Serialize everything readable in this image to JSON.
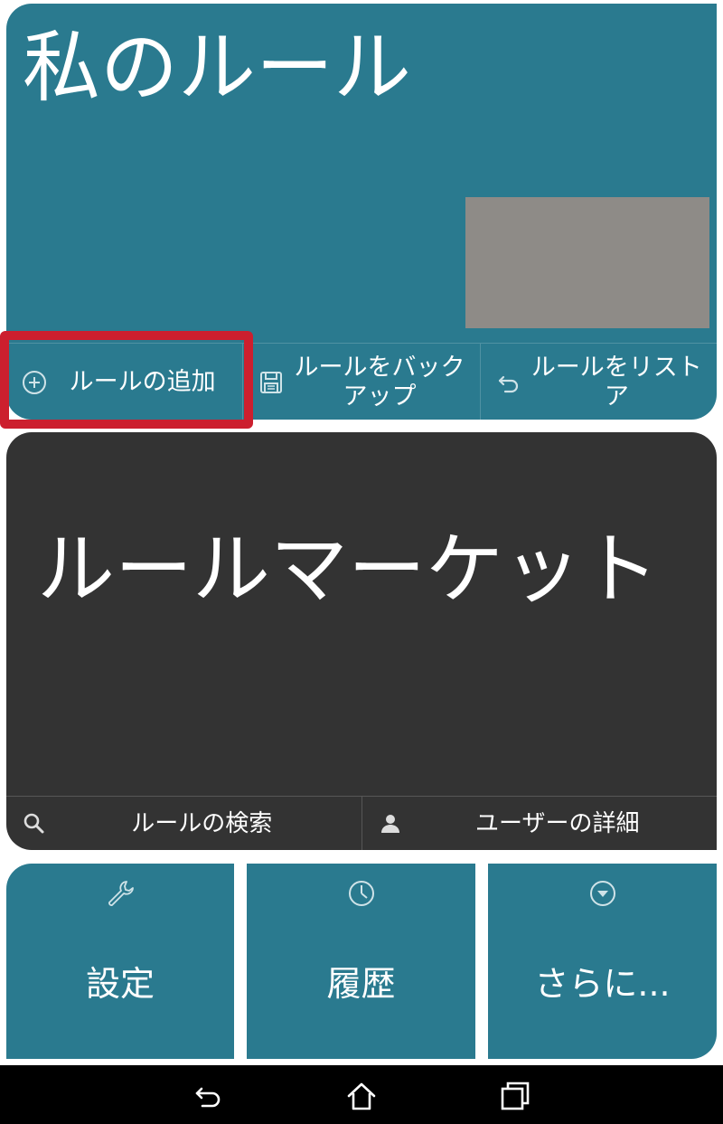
{
  "my_rules": {
    "title": "私のルール",
    "actions": [
      {
        "label": "ルールの追加",
        "icon": "add-circle-icon"
      },
      {
        "label": "ルールをバックアップ",
        "icon": "save-icon"
      },
      {
        "label": "ルールをリストア",
        "icon": "undo-icon"
      }
    ]
  },
  "rule_market": {
    "title": "ルールマーケット",
    "actions": [
      {
        "label": "ルールの検索",
        "icon": "search-icon"
      },
      {
        "label": "ユーザーの詳細",
        "icon": "person-icon"
      }
    ]
  },
  "tiles": [
    {
      "label": "設定",
      "icon": "wrench-icon"
    },
    {
      "label": "履歴",
      "icon": "clock-icon"
    },
    {
      "label": "さらに...",
      "icon": "chevron-down-circle-icon"
    }
  ],
  "navbar": {
    "buttons": [
      "back-icon",
      "home-icon",
      "recent-apps-icon"
    ]
  },
  "colors": {
    "teal_tile": "#2a7a8f",
    "dark_tile": "#333333",
    "highlight": "#cc1f2e"
  }
}
